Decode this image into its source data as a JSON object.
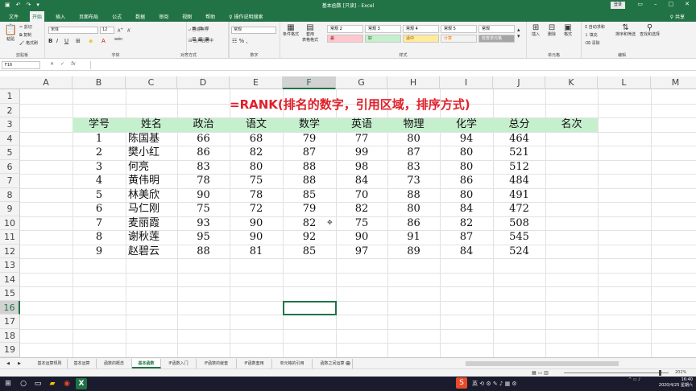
{
  "titlebar": {
    "title": "基本函数 [只读] - Excel",
    "login": "登录"
  },
  "ribbon_tabs": [
    "文件",
    "开始",
    "插入",
    "页面布局",
    "公式",
    "数据",
    "审阅",
    "视图",
    "帮助"
  ],
  "active_tab": "开始",
  "tell_me": "操作说明搜索",
  "share": "共享",
  "ribbon": {
    "clipboard": {
      "label": "剪贴板",
      "paste": "粘贴",
      "cut": "剪切",
      "copy": "复制",
      "format_painter": "格式刷"
    },
    "font": {
      "label": "字体",
      "font_name": "宋体",
      "font_size": "12",
      "wen": "wén"
    },
    "alignment": {
      "label": "对齐方式",
      "wrap": "自动换行",
      "merge": "合并后居中"
    },
    "number": {
      "label": "数字",
      "format": "常规"
    },
    "styles": {
      "label": "样式",
      "conditional": "条件格式",
      "table": "套用\n表格格式",
      "items": [
        {
          "name": "常规 2",
          "bg": "#ffffff",
          "color": "#000000"
        },
        {
          "name": "常规 3",
          "bg": "#ffffff",
          "color": "#000000"
        },
        {
          "name": "常规 4",
          "bg": "#ffffff",
          "color": "#000000"
        },
        {
          "name": "常规 5",
          "bg": "#ffffff",
          "color": "#000000"
        },
        {
          "name": "常规",
          "bg": "#ffffff",
          "color": "#000000"
        },
        {
          "name": "差",
          "bg": "#ffc7ce",
          "color": "#9c0006"
        },
        {
          "name": "好",
          "bg": "#c6efce",
          "color": "#006100"
        },
        {
          "name": "适中",
          "bg": "#ffeb9c",
          "color": "#9c5700"
        },
        {
          "name": "计算",
          "bg": "#f2f2f2",
          "color": "#fa7d00"
        },
        {
          "name": "检查单元格",
          "bg": "#a5a5a5",
          "color": "#ffffff"
        }
      ]
    },
    "cells": {
      "label": "单元格",
      "insert": "插入",
      "delete": "删除",
      "format": "格式"
    },
    "editing": {
      "label": "编辑",
      "autosum": "自动求和",
      "fill": "填充",
      "clear": "清除",
      "sort": "排序和筛选",
      "find": "查找和选择"
    }
  },
  "name_box": "F16",
  "columns": [
    "A",
    "B",
    "C",
    "D",
    "E",
    "F",
    "G",
    "H",
    "I",
    "J",
    "K",
    "L",
    "M"
  ],
  "rows": [
    "1",
    "2",
    "3",
    "4",
    "5",
    "6",
    "7",
    "8",
    "9",
    "10",
    "11",
    "12",
    "13",
    "14",
    "15",
    "16",
    "17",
    "18",
    "19"
  ],
  "selected_col": "F",
  "selected_row": "16",
  "formula_text": "=RANK(排名的数字，引用区域，排序方式)",
  "header_fill": "#c6efce",
  "table": {
    "headers": [
      "学号",
      "姓名",
      "政治",
      "语文",
      "数学",
      "英语",
      "物理",
      "化学",
      "总分",
      "名次"
    ],
    "rows": [
      [
        "1",
        "陈国基",
        "66",
        "68",
        "79",
        "77",
        "80",
        "94",
        "464",
        ""
      ],
      [
        "2",
        "樊小红",
        "86",
        "82",
        "87",
        "99",
        "87",
        "80",
        "521",
        ""
      ],
      [
        "3",
        "何亮",
        "83",
        "80",
        "88",
        "98",
        "83",
        "80",
        "512",
        ""
      ],
      [
        "4",
        "黄伟明",
        "78",
        "75",
        "88",
        "84",
        "73",
        "86",
        "484",
        ""
      ],
      [
        "5",
        "林美欣",
        "90",
        "78",
        "85",
        "70",
        "88",
        "80",
        "491",
        ""
      ],
      [
        "6",
        "马仁刚",
        "75",
        "72",
        "79",
        "82",
        "80",
        "84",
        "472",
        ""
      ],
      [
        "7",
        "麦丽霞",
        "93",
        "90",
        "82",
        "75",
        "86",
        "82",
        "508",
        ""
      ],
      [
        "8",
        "谢秋莲",
        "95",
        "90",
        "92",
        "90",
        "91",
        "87",
        "545",
        ""
      ],
      [
        "9",
        "赵碧云",
        "88",
        "81",
        "85",
        "97",
        "89",
        "84",
        "524",
        ""
      ]
    ]
  },
  "sheet_tabs": [
    "基本运算规则",
    "基本运算",
    "函数的概念",
    "基本函数",
    "IF函数入门",
    "IF函数的嵌套",
    "IF函数套用",
    "单元格的引用",
    "函数之间运算"
  ],
  "active_sheet": "基本函数",
  "status": {
    "zoom": "202%"
  },
  "taskbar": {
    "time": "16:40",
    "date": "2020/4/25 星期六"
  }
}
